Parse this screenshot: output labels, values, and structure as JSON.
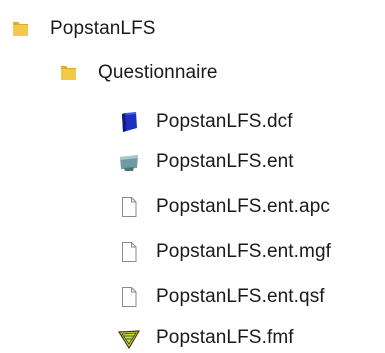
{
  "tree": {
    "root": {
      "label": "PopstanLFS",
      "icon": "folder-icon",
      "children": [
        {
          "label": "Questionnaire",
          "icon": "folder-icon",
          "files": [
            {
              "label": "PopstanLFS.dcf",
              "icon": "dictionary-file-icon"
            },
            {
              "label": "PopstanLFS.ent",
              "icon": "data-entry-app-icon"
            },
            {
              "label": "PopstanLFS.ent.apc",
              "icon": "generic-file-icon"
            },
            {
              "label": "PopstanLFS.ent.mgf",
              "icon": "generic-file-icon"
            },
            {
              "label": "PopstanLFS.ent.qsf",
              "icon": "generic-file-icon"
            },
            {
              "label": "PopstanLFS.fmf",
              "icon": "form-file-icon"
            }
          ]
        }
      ]
    }
  },
  "colors": {
    "folder": "#f3c94a",
    "folder_dark": "#e0ad26",
    "dcf_blue": "#1f2fbf",
    "ent_teal": "#6e9aa3",
    "fmf_yellow": "#e8d13a",
    "text": "#1a1a1a"
  }
}
